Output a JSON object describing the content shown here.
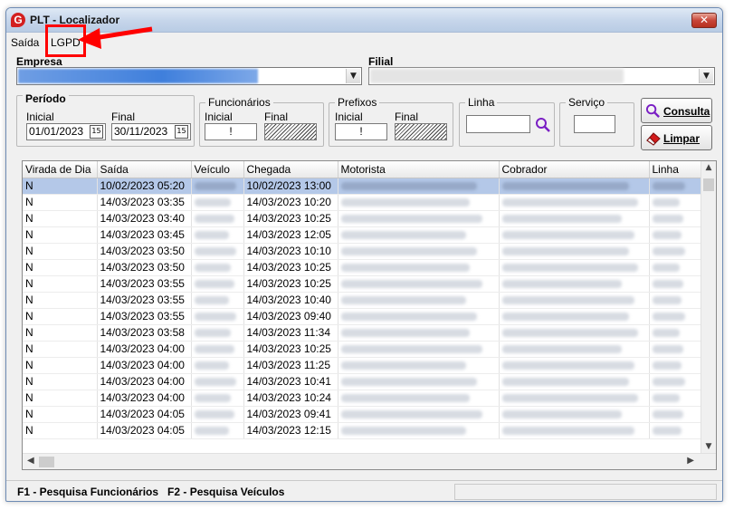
{
  "window": {
    "title": "PLT - Localizador",
    "app_icon": "app-logo-icon",
    "close_glyph": "✕"
  },
  "menu": {
    "items": [
      {
        "label": "Saída"
      },
      {
        "label": "LGPD"
      }
    ]
  },
  "annotation": {
    "color": "#ff0000"
  },
  "empresa": {
    "label": "Empresa",
    "dropdown_icon": "▼"
  },
  "filial": {
    "label": "Filial",
    "dropdown_icon": "▼"
  },
  "periodo": {
    "title": "Período",
    "inicial_label": "Inicial",
    "inicial_value": "01/01/2023",
    "final_label": "Final",
    "final_value": "30/11/2023",
    "calendar_glyph": "15"
  },
  "funcionarios": {
    "title": "Funcionários",
    "inicial_label": "Inicial",
    "inicial_value": "!",
    "final_label": "Final"
  },
  "prefixos": {
    "title": "Prefixos",
    "inicial_label": "Inicial",
    "inicial_value": "!",
    "final_label": "Final"
  },
  "linha": {
    "title": "Linha"
  },
  "servico": {
    "title": "Serviço"
  },
  "buttons": {
    "consulta": "Consulta",
    "limpar": "Limpar"
  },
  "grid": {
    "columns": [
      "Virada de Dia",
      "Saída",
      "Veículo",
      "Chegada",
      "Motorista",
      "Cobrador",
      "Linha"
    ],
    "rows": [
      {
        "virada": "N",
        "saida": "10/02/2023 05:20",
        "chegada": "10/02/2023 13:00",
        "selected": true
      },
      {
        "virada": "N",
        "saida": "14/03/2023 03:35",
        "chegada": "14/03/2023 10:20"
      },
      {
        "virada": "N",
        "saida": "14/03/2023 03:40",
        "chegada": "14/03/2023 10:25"
      },
      {
        "virada": "N",
        "saida": "14/03/2023 03:45",
        "chegada": "14/03/2023 12:05"
      },
      {
        "virada": "N",
        "saida": "14/03/2023 03:50",
        "chegada": "14/03/2023 10:10"
      },
      {
        "virada": "N",
        "saida": "14/03/2023 03:50",
        "chegada": "14/03/2023 10:25"
      },
      {
        "virada": "N",
        "saida": "14/03/2023 03:55",
        "chegada": "14/03/2023 10:25"
      },
      {
        "virada": "N",
        "saida": "14/03/2023 03:55",
        "chegada": "14/03/2023 10:40"
      },
      {
        "virada": "N",
        "saida": "14/03/2023 03:55",
        "chegada": "14/03/2023 09:40"
      },
      {
        "virada": "N",
        "saida": "14/03/2023 03:58",
        "chegada": "14/03/2023 11:34"
      },
      {
        "virada": "N",
        "saida": "14/03/2023 04:00",
        "chegada": "14/03/2023 10:25"
      },
      {
        "virada": "N",
        "saida": "14/03/2023 04:00",
        "chegada": "14/03/2023 11:25"
      },
      {
        "virada": "N",
        "saida": "14/03/2023 04:00",
        "chegada": "14/03/2023 10:41"
      },
      {
        "virada": "N",
        "saida": "14/03/2023 04:00",
        "chegada": "14/03/2023 10:24"
      },
      {
        "virada": "N",
        "saida": "14/03/2023 04:05",
        "chegada": "14/03/2023 09:41"
      },
      {
        "virada": "N",
        "saida": "14/03/2023 04:05",
        "chegada": "14/03/2023 12:15"
      }
    ]
  },
  "status": {
    "text": "F1 - Pesquisa Funcionários   F2 - Pesquisa Veículos"
  }
}
